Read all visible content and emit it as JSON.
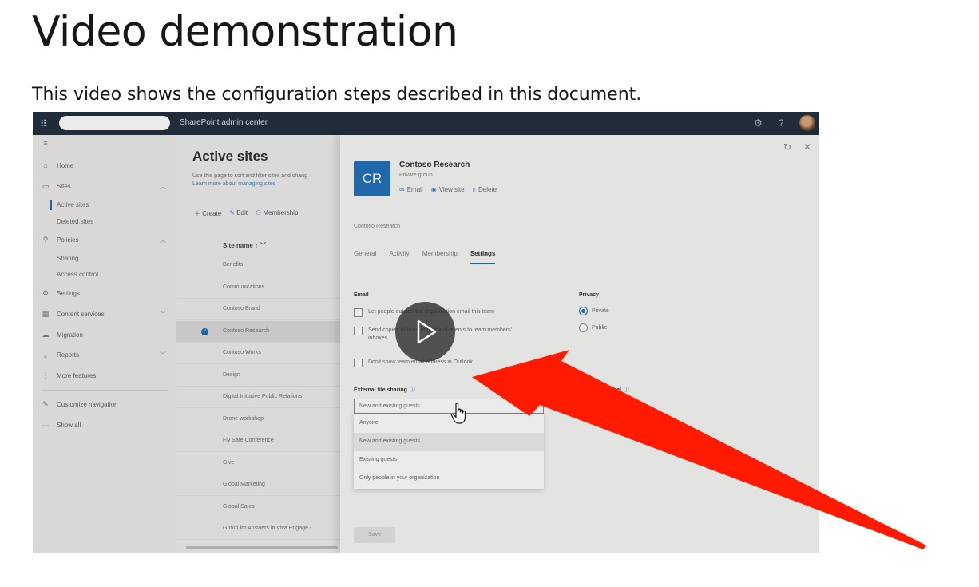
{
  "page": {
    "title": "Video demonstration",
    "intro": "This video shows the configuration steps described in this document."
  },
  "video": {
    "topbar": {
      "app_name": "SharePoint admin center",
      "icons": [
        "waffle-icon",
        "gear-icon",
        "help-icon",
        "avatar"
      ]
    },
    "leftnav": {
      "items": [
        {
          "label": "Home",
          "icon": "home-icon"
        },
        {
          "label": "Sites",
          "icon": "sites-icon"
        },
        {
          "label": "Policies",
          "icon": "policies-icon"
        },
        {
          "label": "Settings",
          "icon": "gear-icon"
        },
        {
          "label": "Content services",
          "icon": "content-icon"
        },
        {
          "label": "Migration",
          "icon": "cloud-icon"
        },
        {
          "label": "Reports",
          "icon": "chart-icon"
        },
        {
          "label": "More features",
          "icon": "more-icon"
        },
        {
          "label": "Customize navigation",
          "icon": "pencil-icon"
        },
        {
          "label": "Show all",
          "icon": "ellipsis-icon"
        }
      ],
      "subitems": {
        "sites": [
          "Active sites",
          "Deleted sites"
        ],
        "policies": [
          "Sharing",
          "Access control"
        ]
      }
    },
    "main": {
      "title": "Active sites",
      "desc_line1": "Use this page to sort and filter sites and chang",
      "desc_link": "Learn more about managing sites",
      "commands": [
        "Create",
        "Edit",
        "Membership"
      ],
      "column_header": "Site name ↑ ﹀",
      "rows": [
        "Benefits",
        "Communications",
        "Contoso Brand",
        "Contoso Research",
        "Contoso Works",
        "Design",
        "Digital Initiative Public Relations",
        "Drone workshop",
        "Fly Safe Conference",
        "Give",
        "Global Marketing",
        "Global Sales",
        "Group for Answers in Viva Engage -..."
      ],
      "selected_row": "Contoso Research"
    },
    "panel": {
      "badge": "CR",
      "site_name": "Contoso Research",
      "site_type": "Private group",
      "actions": [
        {
          "label": "Email",
          "icon": "mail-icon"
        },
        {
          "label": "View site",
          "icon": "globe-icon"
        },
        {
          "label": "Delete",
          "icon": "trash-icon"
        }
      ],
      "breadcrumb": "Contoso Research",
      "tabs": [
        "General",
        "Activity",
        "Membership",
        "Settings"
      ],
      "active_tab": "Settings",
      "email_heading": "Email",
      "email_options": [
        "Let people outside the organization email this team",
        "Send copies of team emails and events to team members' inboxes",
        "Don't show team email address in Outlook"
      ],
      "privacy_heading": "Privacy",
      "privacy_options": [
        "Private",
        "Public"
      ],
      "privacy_selected": "Private",
      "sharing_heading": "External file sharing",
      "sensitivity_heading": "Sensitivity label",
      "sharing_value": "New and existing guests",
      "sharing_options": [
        "Anyone",
        "New and existing guests",
        "Existing guests",
        "Only people in your organization"
      ],
      "save_label": "Save"
    },
    "accent": "#0f6cbd",
    "arrow_color": "#ff1a00"
  }
}
